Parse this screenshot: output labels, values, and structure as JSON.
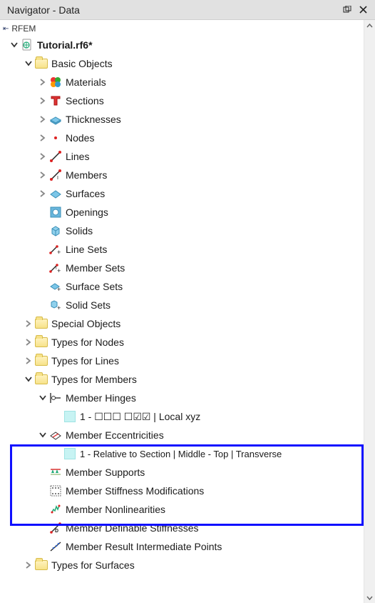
{
  "titlebar": {
    "title": "Navigator - Data"
  },
  "root": {
    "app": "RFEM"
  },
  "file": {
    "name": "Tutorial.rf6*"
  },
  "basicObjects": {
    "label": "Basic Objects",
    "materials": "Materials",
    "sections": "Sections",
    "thicknesses": "Thicknesses",
    "nodes": "Nodes",
    "lines": "Lines",
    "members": "Members",
    "surfaces": "Surfaces",
    "openings": "Openings",
    "solids": "Solids",
    "lineSets": "Line Sets",
    "memberSets": "Member Sets",
    "surfaceSets": "Surface Sets",
    "solidSets": "Solid Sets"
  },
  "specialObjects": {
    "label": "Special Objects"
  },
  "typesForNodes": {
    "label": "Types for Nodes"
  },
  "typesForLines": {
    "label": "Types for Lines"
  },
  "typesForMembers": {
    "label": "Types for Members",
    "memberHinges": {
      "label": "Member Hinges",
      "item1": "1 - ☐☐☐ ☐☑☑ | Local xyz"
    },
    "memberEccentricities": {
      "label": "Member Eccentricities",
      "item1": "1 - Relative to Section | Middle - Top | Transverse"
    },
    "memberSupports": "Member Supports",
    "memberStiffnessMods": "Member Stiffness Modifications",
    "memberNonlinearities": "Member Nonlinearities",
    "memberDefinableStiff": "Member Definable Stiffnesses",
    "memberResultInterPts": "Member Result Intermediate Points"
  },
  "typesForSurfaces": {
    "label": "Types for Surfaces"
  }
}
